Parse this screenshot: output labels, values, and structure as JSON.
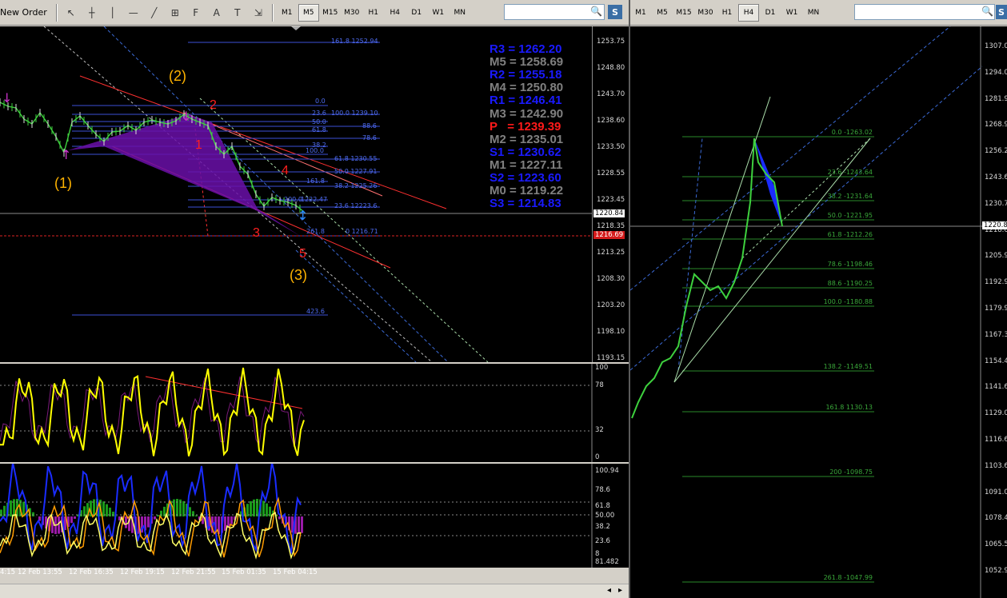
{
  "toolbar_left": {
    "new_order": "New Order",
    "objects": [
      {
        "name": "cursor-icon",
        "glyph": "↖"
      },
      {
        "name": "crosshair-icon",
        "glyph": "┼"
      },
      {
        "name": "vertical-line-icon",
        "glyph": "│"
      },
      {
        "name": "horizontal-line-icon",
        "glyph": "—"
      },
      {
        "name": "trendline-icon",
        "glyph": "╱"
      },
      {
        "name": "channel-icon",
        "glyph": "⊞"
      },
      {
        "name": "fibonacci-icon",
        "glyph": "F"
      },
      {
        "name": "text-icon",
        "glyph": "A"
      },
      {
        "name": "text-label-icon",
        "glyph": "T"
      },
      {
        "name": "arrows-icon",
        "glyph": "⇲"
      }
    ],
    "timeframes": [
      "M1",
      "M5",
      "M15",
      "M30",
      "H1",
      "H4",
      "D1",
      "W1",
      "MN"
    ],
    "active_timeframe": "M5"
  },
  "toolbar_right": {
    "timeframes": [
      "M1",
      "M5",
      "M15",
      "M30",
      "H1",
      "H4",
      "D1",
      "W1",
      "MN"
    ],
    "active_timeframe": "H4"
  },
  "left_chart": {
    "price_labels": [
      "1253.75",
      "1248.80",
      "1243.70",
      "1238.60",
      "1233.50",
      "1228.55",
      "1223.45",
      "1218.35",
      "1213.25",
      "1208.30",
      "1203.20",
      "1198.10",
      "1193.15"
    ],
    "current_price": "1220.84",
    "red_price": "1216.69",
    "pivots": [
      {
        "text": "R3 = 1262.20",
        "color": "#1a1aff"
      },
      {
        "text": "M5 = 1258.69",
        "color": "#808080"
      },
      {
        "text": "R2 = 1255.18",
        "color": "#1a1aff"
      },
      {
        "text": "M4 = 1250.80",
        "color": "#808080"
      },
      {
        "text": "R1 = 1246.41",
        "color": "#1a1aff"
      },
      {
        "text": "M3 = 1242.90",
        "color": "#808080"
      },
      {
        "text": "P   = 1239.39",
        "color": "#ff1a1a"
      },
      {
        "text": "M2 = 1235.01",
        "color": "#808080"
      },
      {
        "text": "S1 = 1230.62",
        "color": "#1a1aff"
      },
      {
        "text": "M1 = 1227.11",
        "color": "#808080"
      },
      {
        "text": "S2 = 1223.60",
        "color": "#1a1aff"
      },
      {
        "text": "M0 = 1219.22",
        "color": "#808080"
      },
      {
        "text": "S3 = 1214.83",
        "color": "#1a1aff"
      }
    ],
    "waves": [
      "(1)",
      "(2)",
      "(3)",
      "1",
      "2",
      "3",
      "4",
      "5"
    ],
    "fib_labels": [
      "161.8 1252.94",
      "0.0",
      "23.6",
      "100.0 1239.10",
      "50.0",
      "88.6",
      "61.8",
      "78.6",
      "38.2",
      "100.0",
      "61.8 1230.55",
      "50.0 1227.91",
      "161.8",
      "38.2 1225.26",
      "200.0",
      "1222.47",
      "23.6 12223.6",
      "261.8",
      "0 1216.71",
      "423.6"
    ],
    "osc1_labels": [
      "100",
      "78",
      "32",
      "0"
    ],
    "osc2_labels": [
      "100.94",
      "78.6",
      "61.8",
      "50.00",
      "38.2",
      "23.6",
      "8",
      "81.482"
    ],
    "time_labels": [
      "4:15",
      "12 Feb 13:55",
      "12 Feb 16:35",
      "12 Feb 19:15",
      "12 Feb 21:55",
      "15 Feb 01:35",
      "15 Feb 04:15"
    ]
  },
  "right_chart": {
    "price_labels": [
      "1307.0",
      "1294.0",
      "1281.9",
      "1268.9",
      "1256.2",
      "1243.6",
      "1230.7",
      "1218.0",
      "1205.9",
      "1192.9",
      "1179.9",
      "1167.3",
      "1154.4",
      "1141.6",
      "1129.0",
      "1116.6",
      "1103.6",
      "1091.0",
      "1078.4",
      "1065.5",
      "1052.9"
    ],
    "current_price": "1220.8",
    "fib_labels": [
      "0.0 -1263.02",
      "23.6 -1243.64",
      "38.2 -1231.64",
      "50.0 -1221.95",
      "61.8 -1212.26",
      "78.6 -1198.46",
      "88.6 -1190.25",
      "100.0 -1180.88",
      "138.2 -1149.51",
      "161.8 1130.13",
      "200 -1098.75",
      "261.8 -1047.99"
    ]
  }
}
